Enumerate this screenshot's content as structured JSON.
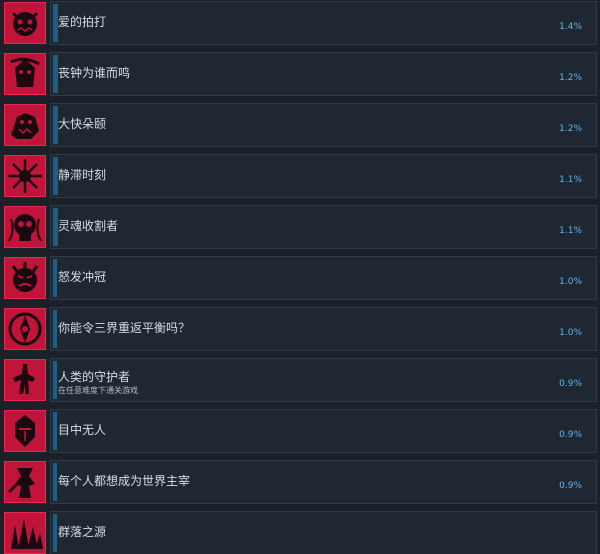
{
  "achievements": [
    {
      "name": "爱的拍打",
      "description": "",
      "percent": "1.4%",
      "fill": 0.01,
      "icon": "demon-face-icon"
    },
    {
      "name": "丧钟为谁而鸣",
      "description": "",
      "percent": "1.2%",
      "fill": 0.01,
      "icon": "reaper-icon"
    },
    {
      "name": "大快朵颐",
      "description": "",
      "percent": "1.2%",
      "fill": 0.01,
      "icon": "beast-icon"
    },
    {
      "name": "静滞时刻",
      "description": "",
      "percent": "1.1%",
      "fill": 0.01,
      "icon": "starburst-icon"
    },
    {
      "name": "灵魂收割者",
      "description": "",
      "percent": "1.1%",
      "fill": 0.01,
      "icon": "soul-skull-icon"
    },
    {
      "name": "怒发冲冠",
      "description": "",
      "percent": "1.0%",
      "fill": 0.008,
      "icon": "rage-face-icon"
    },
    {
      "name": "你能令三界重返平衡吗？",
      "description": "",
      "percent": "1.0%",
      "fill": 0.008,
      "icon": "balance-emblem-icon"
    },
    {
      "name": "人类的守护者",
      "description": "在任意难度下通关游戏",
      "percent": "0.9%",
      "fill": 0.008,
      "icon": "guardian-silhouette-icon"
    },
    {
      "name": "目中无人",
      "description": "",
      "percent": "0.9%",
      "fill": 0.008,
      "icon": "helmet-icon"
    },
    {
      "name": "每个人都想成为世界主宰",
      "description": "",
      "percent": "0.9%",
      "fill": 0.008,
      "icon": "warrior-icon"
    },
    {
      "name": "群落之源",
      "description": "",
      "percent": "",
      "fill": 0.008,
      "icon": "crystal-cluster-icon"
    }
  ],
  "colors": {
    "background": "#1b2129",
    "icon_red": "#c0143a",
    "card": "#1f2732",
    "progress": "#1c5f84",
    "percent_text": "#67b3e6"
  }
}
